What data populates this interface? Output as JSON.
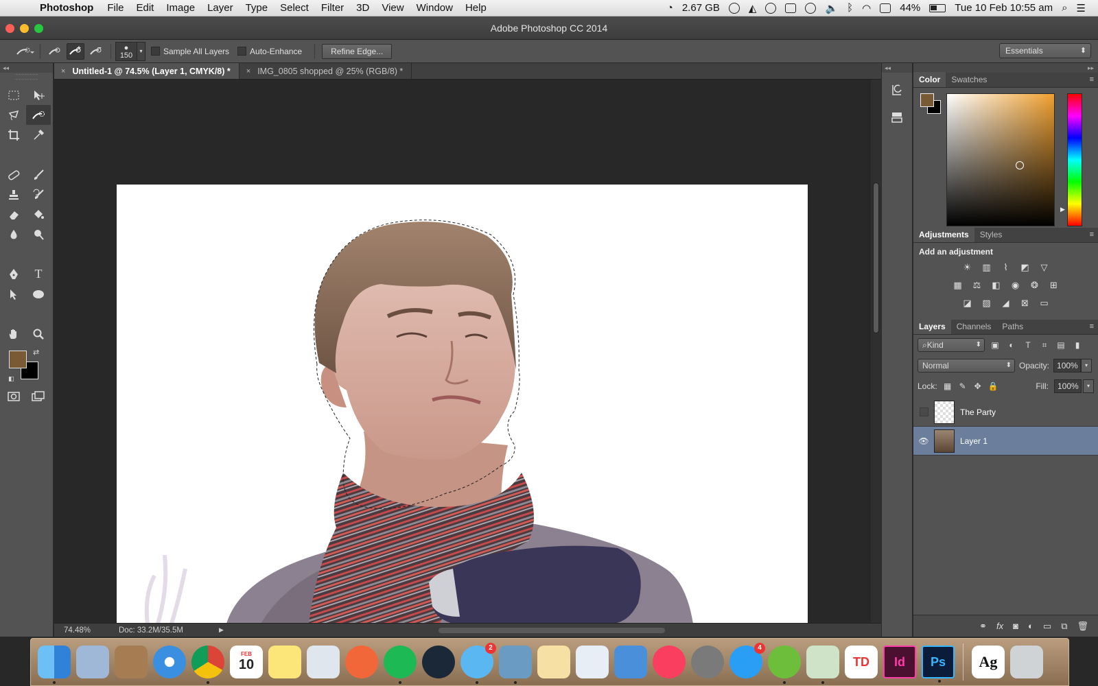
{
  "menubar": {
    "app_name": "Photoshop",
    "items": [
      "File",
      "Edit",
      "Image",
      "Layer",
      "Type",
      "Select",
      "Filter",
      "3D",
      "View",
      "Window",
      "Help"
    ],
    "memory": "2.67 GB",
    "battery": "44%",
    "datetime": "Tue 10 Feb  10:55 am"
  },
  "window": {
    "title": "Adobe Photoshop CC 2014"
  },
  "options": {
    "brush_size": "150",
    "sample_all_layers": "Sample All Layers",
    "auto_enhance": "Auto-Enhance",
    "refine_edge": "Refine Edge...",
    "workspace": "Essentials"
  },
  "tabs": [
    {
      "label": "Untitled-1 @ 74.5% (Layer 1, CMYK/8) *",
      "active": true
    },
    {
      "label": "IMG_0805 shopped @ 25% (RGB/8) *",
      "active": false
    }
  ],
  "status": {
    "zoom": "74.48%",
    "doc": "Doc: 33.2M/35.5M"
  },
  "colors": {
    "foreground": "#7a5a34",
    "background": "#000000",
    "selected_layer": "#6b7f9c"
  },
  "color_panel": {
    "tabs": [
      "Color",
      "Swatches"
    ]
  },
  "adjustments_panel": {
    "tabs": [
      "Adjustments",
      "Styles"
    ],
    "title": "Add an adjustment"
  },
  "layers_panel": {
    "tabs": [
      "Layers",
      "Channels",
      "Paths"
    ],
    "kind": "Kind",
    "blend_mode": "Normal",
    "opacity_label": "Opacity:",
    "opacity": "100%",
    "lock_label": "Lock:",
    "fill_label": "Fill:",
    "fill": "100%",
    "layers": [
      {
        "name": "The Party",
        "visible": false
      },
      {
        "name": "Layer 1",
        "visible": true,
        "selected": true
      }
    ]
  },
  "dock": {
    "calendar_month": "FEB",
    "calendar_day": "10",
    "messages_badge": "2",
    "appstore_badge": "4",
    "indesign": "Id",
    "photoshop": "Ps",
    "fontbook": "Ag"
  }
}
